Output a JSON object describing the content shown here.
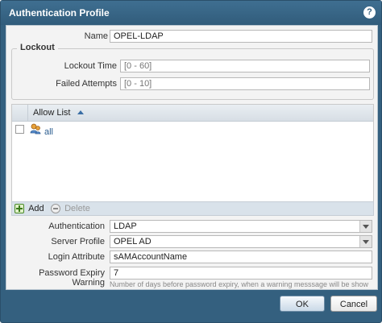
{
  "dialog": {
    "title": "Authentication Profile",
    "help_icon": "help-icon"
  },
  "form": {
    "name_label": "Name",
    "name_value": "OPEL-LDAP",
    "lockout": {
      "legend": "Lockout",
      "time_label": "Lockout Time",
      "time_placeholder": "[0 - 60]",
      "attempts_label": "Failed Attempts",
      "attempts_placeholder": "[0 - 10]"
    },
    "allow_list": {
      "header": "Allow List",
      "sort": "ascending",
      "rows": [
        {
          "value": "all",
          "icon": "user-group-icon"
        }
      ],
      "add_label": "Add",
      "delete_label": "Delete"
    },
    "authentication_label": "Authentication",
    "authentication_value": "LDAP",
    "server_profile_label": "Server Profile",
    "server_profile_value": "OPEL AD",
    "login_attribute_label": "Login Attribute",
    "login_attribute_value": "sAMAccountName",
    "password_expiry_label": "Password Expiry Warning",
    "password_expiry_value": "7",
    "password_expiry_hint": "Number of days before password expiry, when a warning messsage will be show"
  },
  "buttons": {
    "ok": "OK",
    "cancel": "Cancel"
  }
}
